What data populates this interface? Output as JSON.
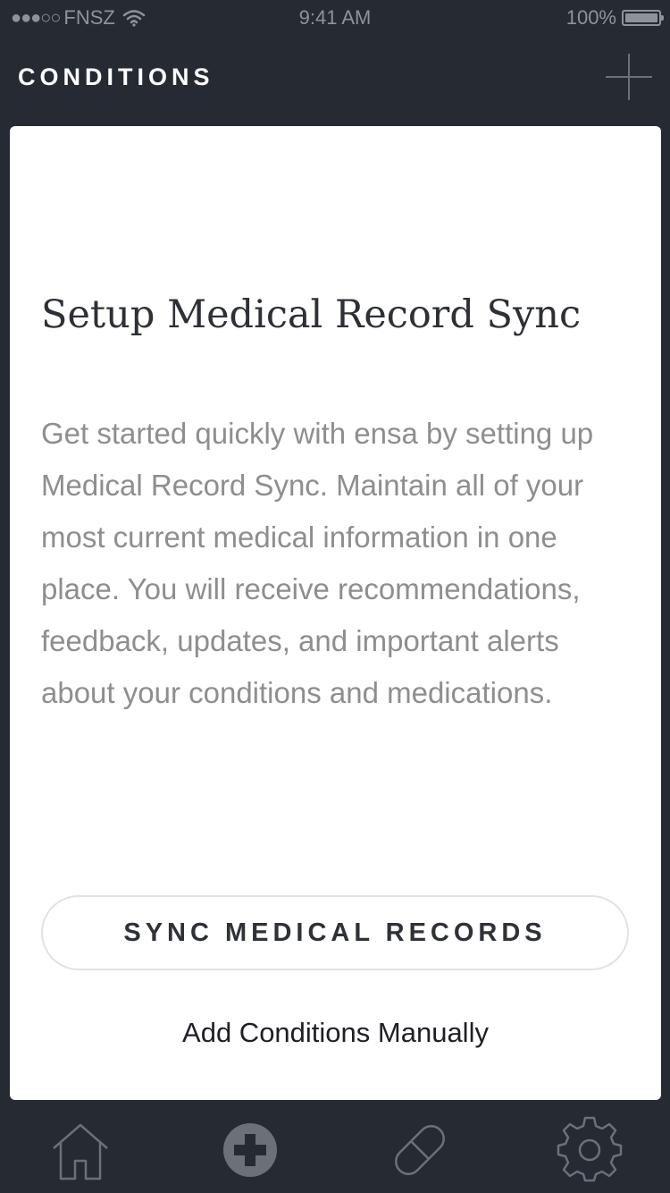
{
  "status_bar": {
    "signal": "●●●○○",
    "carrier": "FNSZ",
    "time": "9:41 AM",
    "battery": "100%",
    "wifi_icon": "wifi-icon",
    "battery_icon": "battery-icon"
  },
  "nav": {
    "title": "CONDITIONS",
    "add_icon": "plus-icon"
  },
  "card": {
    "title": "Setup Medical Record Sync",
    "body": "Get started quickly with ensa by setting up Medical Record Sync. Maintain all of your most current medical information in one place. You will receive recommendations, feedback, updates, and important alerts about your conditions and medications.",
    "primary_button": "SYNC MEDICAL RECORDS",
    "secondary_link": "Add Conditions Manually"
  },
  "tab_bar": {
    "tabs": [
      {
        "icon": "home-icon",
        "active": false
      },
      {
        "icon": "medical-cross-icon",
        "active": true
      },
      {
        "icon": "pill-icon",
        "active": false
      },
      {
        "icon": "gear-icon",
        "active": false
      }
    ]
  },
  "colors": {
    "background": "#262b33",
    "card": "#ffffff",
    "tab_icon": "#6b7079",
    "body_text": "#8e8e8e"
  }
}
